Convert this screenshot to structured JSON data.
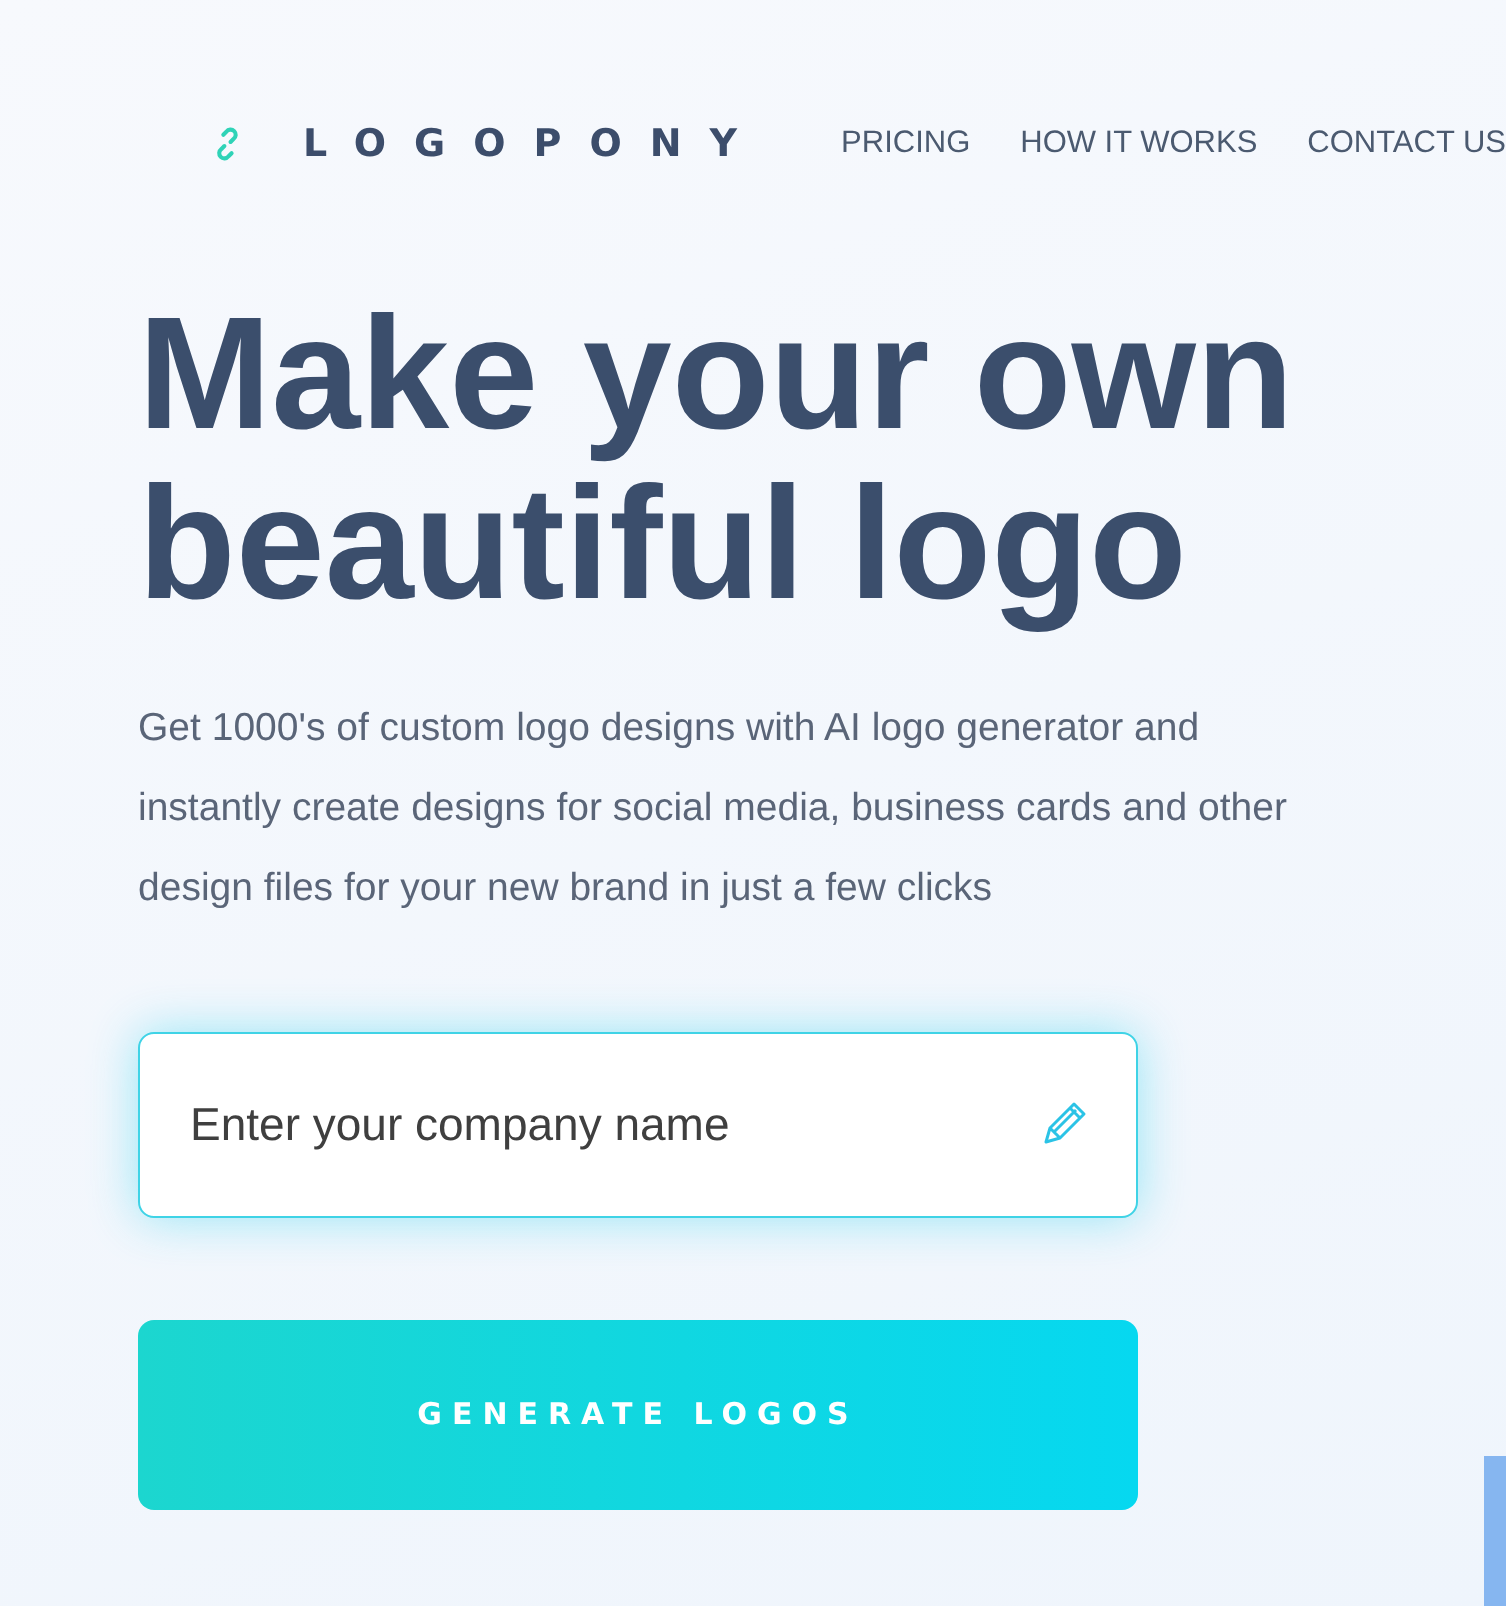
{
  "brand": {
    "name": "LOGOPONY"
  },
  "nav": [
    {
      "label": "PRICING"
    },
    {
      "label": "HOW IT WORKS"
    },
    {
      "label": "CONTACT US"
    }
  ],
  "hero": {
    "title": "Make your own beautiful logo",
    "subtitle": "Get 1000's of custom logo designs with AI logo generator and instantly create designs for social media, business cards and other design files for your new brand in just a few clicks"
  },
  "company_field": {
    "placeholder": "Enter your company name"
  },
  "generate_button": {
    "label": "GENERATE LOGOS"
  }
}
